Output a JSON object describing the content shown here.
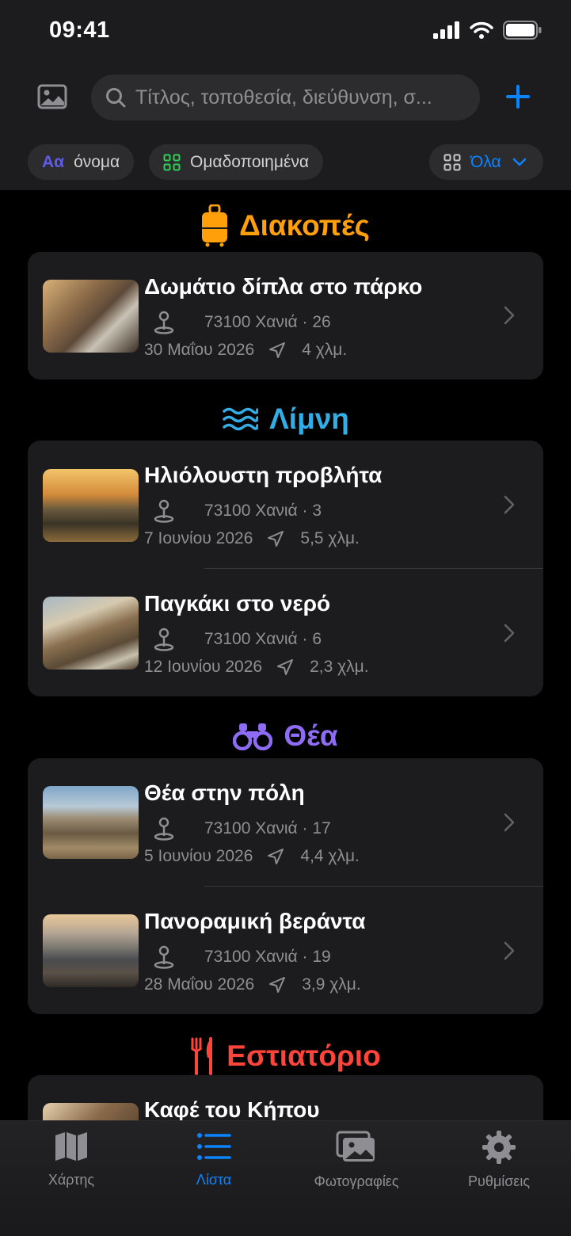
{
  "status": {
    "time": "09:41"
  },
  "search": {
    "placeholder": "Τίτλος, τοποθεσία, διεύθυνση, σ..."
  },
  "filters": {
    "sort_prefix": "Aα",
    "sort_label": "όνομα",
    "group_label": "Ομαδοποιημένα",
    "scope_label": "Όλα"
  },
  "sections": [
    {
      "title": "Διακοπές",
      "color": "#ff9f0a",
      "icon": "suitcase-icon",
      "items": [
        {
          "title": "Δωμάτιο δίπλα στο πάρκο",
          "location": "73100 Χανιά · 26",
          "date": "30 Μαΐου 2026",
          "distance": "4 χλμ."
        }
      ]
    },
    {
      "title": "Λίμνη",
      "color": "#32ade6",
      "icon": "water-waves-icon",
      "items": [
        {
          "title": "Ηλιόλουστη προβλήτα",
          "location": "73100 Χανιά · 3",
          "date": "7 Ιουνίου 2026",
          "distance": "5,5 χλμ."
        },
        {
          "title": "Παγκάκι στο νερό",
          "location": "73100 Χανιά · 6",
          "date": "12 Ιουνίου 2026",
          "distance": "2,3 χλμ."
        }
      ]
    },
    {
      "title": "Θέα",
      "color": "#8e6cf5",
      "icon": "binoculars-icon",
      "items": [
        {
          "title": "Θέα στην πόλη",
          "location": "73100 Χανιά · 17",
          "date": "5 Ιουνίου 2026",
          "distance": "4,4 χλμ."
        },
        {
          "title": "Πανοραμική βεράντα",
          "location": "73100 Χανιά · 19",
          "date": "28 Μαΐου 2026",
          "distance": "3,9 χλμ."
        }
      ]
    },
    {
      "title": "Εστιατόριο",
      "color": "#ff453a",
      "icon": "fork-knife-icon",
      "items": [
        {
          "title": "Καφέ του Κήπου"
        }
      ]
    }
  ],
  "tabs": [
    {
      "label": "Χάρτης",
      "icon": "map-icon"
    },
    {
      "label": "Λίστα",
      "icon": "list-icon"
    },
    {
      "label": "Φωτογραφίες",
      "icon": "photos-icon"
    },
    {
      "label": "Ρυθμίσεις",
      "icon": "gear-icon"
    }
  ],
  "colors": {
    "accent": "#0a84ff",
    "background": "#000000",
    "card": "#1c1c1e"
  }
}
